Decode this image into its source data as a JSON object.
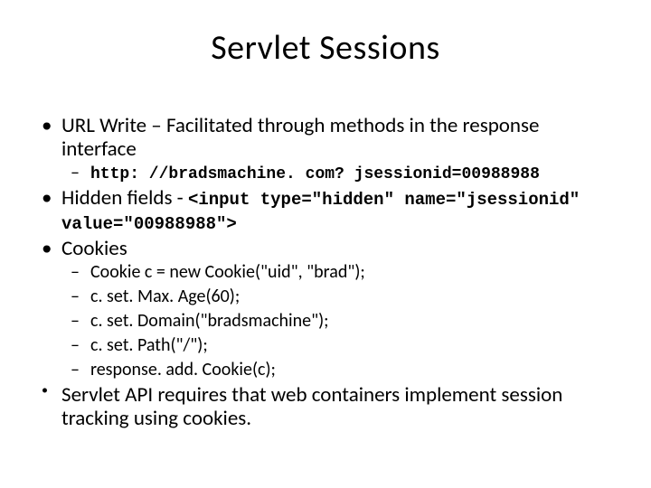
{
  "slide": {
    "title": "Servlet Sessions",
    "bullets": {
      "url_write": {
        "text": "URL Write – Facilitated through methods in the response interface",
        "sub": {
          "example": "http: //bradsmachine. com? jsessionid=00988988"
        }
      },
      "hidden_fields": {
        "label": "Hidden fields",
        "sep": " - ",
        "code": "<input type=\"hidden\" name=\"jsessionid\" value=\"00988988\">"
      },
      "cookies": {
        "label": "Cookies",
        "lines": {
          "l1": "Cookie c = new Cookie(\"uid\", \"brad\");",
          "l2": "c. set. Max. Age(60);",
          "l3": "c. set. Domain(\"bradsmachine\");",
          "l4": "c. set. Path(\"/\");",
          "l5": "response. add. Cookie(c);"
        }
      },
      "note": {
        "text": "Servlet API requires that web containers implement session tracking using cookies."
      }
    }
  }
}
